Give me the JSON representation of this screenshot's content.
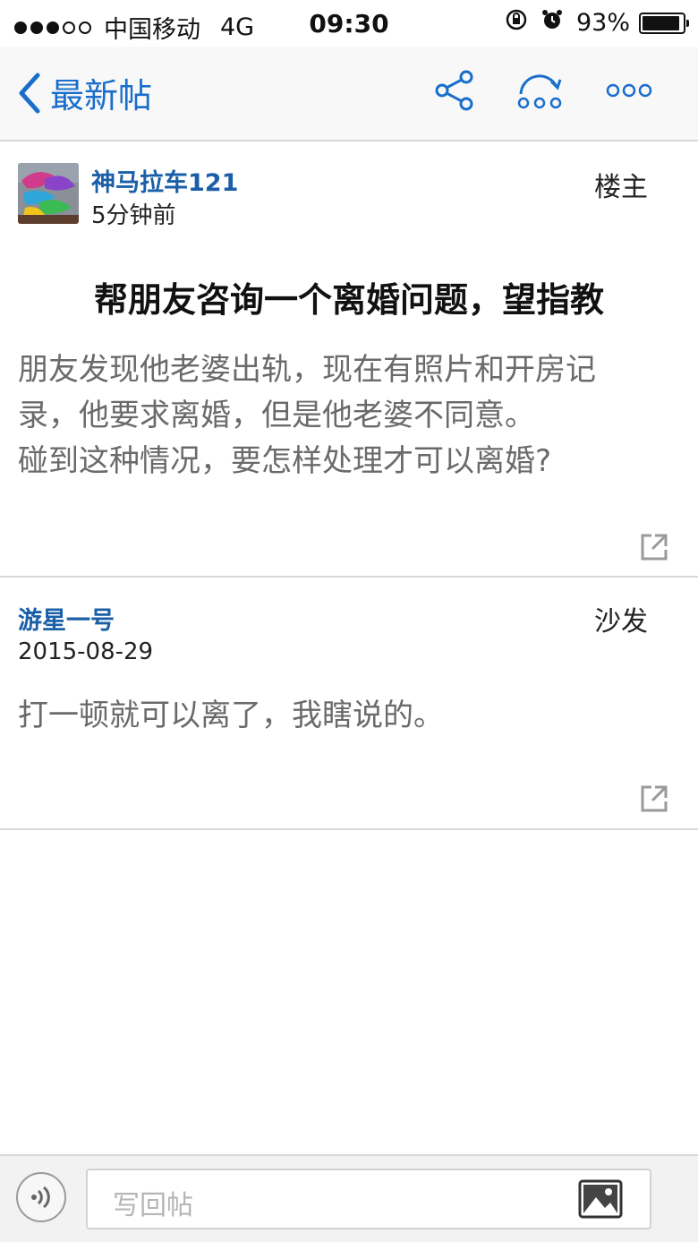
{
  "status_bar": {
    "carrier": "中国移动",
    "network": "4G",
    "time": "09:30",
    "battery": "93%",
    "battery_level": 0.93,
    "signal_bars_filled": 3,
    "signal_bars_total": 5
  },
  "nav": {
    "back_label": "最新帖",
    "accent_color": "#1a6ecb"
  },
  "post": {
    "author": "神马拉车121",
    "time": "5分钟前",
    "floor": "楼主",
    "title": "帮朋友咨询一个离婚问题，望指教",
    "body_lines": [
      "朋友发现他老婆出轨，现在有照片和开房记",
      "录，他要求离婚，但是他老婆不同意。",
      "碰到这种情况，要怎样处理才可以离婚?"
    ]
  },
  "reply": {
    "author": "游星一号",
    "date": "2015-08-29",
    "floor": "沙发",
    "body": "打一顿就可以离了，我瞎说的。"
  },
  "composer": {
    "placeholder": "写回帖"
  },
  "icons": {
    "share": "share-icon",
    "loop": "loop-icon",
    "more": "more-icon",
    "external": "external-link-icon",
    "voice": "voice-icon",
    "image": "image-icon"
  }
}
